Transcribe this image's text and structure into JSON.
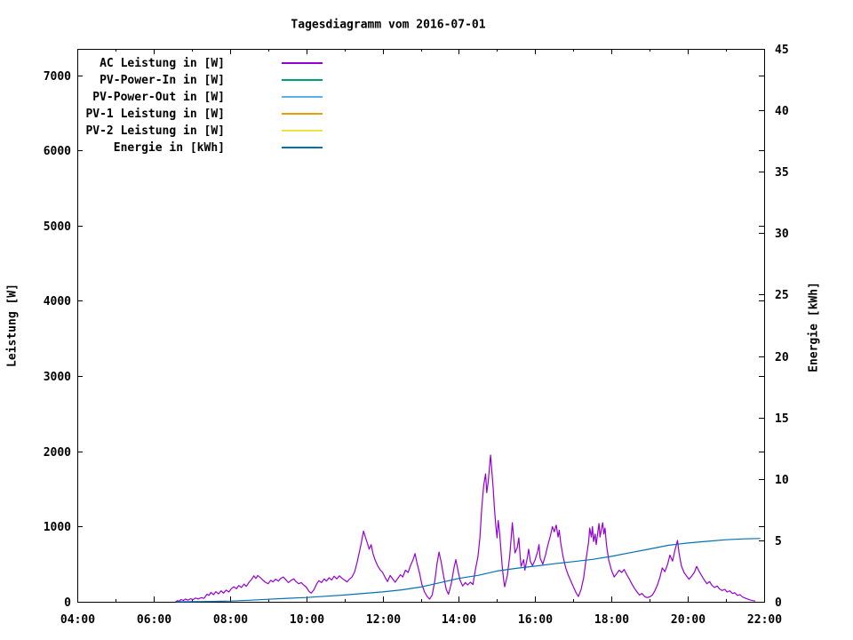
{
  "page": {
    "background": "#ffffff"
  },
  "chart_data": {
    "type": "line",
    "title": "Tagesdiagramm vom 2016-07-01",
    "ylabel": "Leistung [W]",
    "y2label": "Energie [kWh]",
    "legend_position": "top-left-inside",
    "grid": false,
    "x_axis": {
      "unit": "time",
      "start_hour": 4,
      "end_hour": 22,
      "major_tick_every_hours": 2,
      "minor_tick_every_hours": 1,
      "tick_labels": [
        "04:00",
        "06:00",
        "08:00",
        "10:00",
        "12:00",
        "14:00",
        "16:00",
        "18:00",
        "20:00",
        "22:00"
      ]
    },
    "y_axis": {
      "label": "Leistung [W]",
      "min": 0,
      "max_displayed_tick": 7000,
      "range_max": 7350,
      "tick_step": 1000,
      "tick_labels": [
        "0",
        "1000",
        "2000",
        "3000",
        "4000",
        "5000",
        "6000",
        "7000"
      ]
    },
    "y2_axis": {
      "label": "Energie [kWh]",
      "min": 0,
      "max": 45,
      "tick_step": 5,
      "tick_labels": [
        "0",
        "5",
        "10",
        "15",
        "20",
        "25",
        "30",
        "35",
        "40",
        "45"
      ]
    },
    "series": [
      {
        "name": "AC Leistung in [W]",
        "color": "#9400d3",
        "axis": "y1",
        "points": [
          [
            6.58,
            0
          ],
          [
            6.62,
            15
          ],
          [
            6.67,
            8
          ],
          [
            6.72,
            30
          ],
          [
            6.78,
            18
          ],
          [
            6.83,
            35
          ],
          [
            6.9,
            22
          ],
          [
            6.97,
            40
          ],
          [
            7.03,
            28
          ],
          [
            7.1,
            50
          ],
          [
            7.17,
            38
          ],
          [
            7.25,
            55
          ],
          [
            7.32,
            45
          ],
          [
            7.4,
            100
          ],
          [
            7.45,
            85
          ],
          [
            7.5,
            125
          ],
          [
            7.57,
            95
          ],
          [
            7.63,
            135
          ],
          [
            7.7,
            105
          ],
          [
            7.77,
            145
          ],
          [
            7.83,
            115
          ],
          [
            7.9,
            155
          ],
          [
            7.97,
            130
          ],
          [
            8.03,
            170
          ],
          [
            8.1,
            200
          ],
          [
            8.17,
            175
          ],
          [
            8.23,
            215
          ],
          [
            8.3,
            190
          ],
          [
            8.37,
            235
          ],
          [
            8.43,
            205
          ],
          [
            8.5,
            260
          ],
          [
            8.57,
            300
          ],
          [
            8.63,
            345
          ],
          [
            8.68,
            310
          ],
          [
            8.73,
            350
          ],
          [
            8.8,
            320
          ],
          [
            8.87,
            285
          ],
          [
            8.93,
            260
          ],
          [
            9.0,
            240
          ],
          [
            9.07,
            285
          ],
          [
            9.13,
            265
          ],
          [
            9.2,
            300
          ],
          [
            9.27,
            275
          ],
          [
            9.33,
            310
          ],
          [
            9.4,
            330
          ],
          [
            9.47,
            290
          ],
          [
            9.53,
            255
          ],
          [
            9.6,
            285
          ],
          [
            9.67,
            305
          ],
          [
            9.73,
            270
          ],
          [
            9.8,
            240
          ],
          [
            9.87,
            255
          ],
          [
            9.93,
            225
          ],
          [
            10.0,
            195
          ],
          [
            10.07,
            140
          ],
          [
            10.13,
            115
          ],
          [
            10.2,
            160
          ],
          [
            10.27,
            235
          ],
          [
            10.33,
            280
          ],
          [
            10.4,
            255
          ],
          [
            10.47,
            305
          ],
          [
            10.53,
            275
          ],
          [
            10.6,
            320
          ],
          [
            10.67,
            290
          ],
          [
            10.73,
            340
          ],
          [
            10.8,
            305
          ],
          [
            10.87,
            345
          ],
          [
            10.93,
            315
          ],
          [
            11.0,
            290
          ],
          [
            11.07,
            265
          ],
          [
            11.13,
            300
          ],
          [
            11.2,
            330
          ],
          [
            11.27,
            400
          ],
          [
            11.33,
            520
          ],
          [
            11.4,
            680
          ],
          [
            11.45,
            800
          ],
          [
            11.5,
            940
          ],
          [
            11.55,
            860
          ],
          [
            11.6,
            780
          ],
          [
            11.65,
            700
          ],
          [
            11.7,
            760
          ],
          [
            11.75,
            640
          ],
          [
            11.8,
            560
          ],
          [
            11.87,
            480
          ],
          [
            11.93,
            430
          ],
          [
            12.0,
            390
          ],
          [
            12.07,
            320
          ],
          [
            12.13,
            270
          ],
          [
            12.2,
            350
          ],
          [
            12.27,
            300
          ],
          [
            12.33,
            260
          ],
          [
            12.4,
            310
          ],
          [
            12.47,
            360
          ],
          [
            12.53,
            330
          ],
          [
            12.6,
            420
          ],
          [
            12.67,
            390
          ],
          [
            12.73,
            480
          ],
          [
            12.8,
            560
          ],
          [
            12.85,
            640
          ],
          [
            12.9,
            520
          ],
          [
            12.97,
            380
          ],
          [
            13.03,
            230
          ],
          [
            13.1,
            130
          ],
          [
            13.17,
            70
          ],
          [
            13.23,
            35
          ],
          [
            13.3,
            90
          ],
          [
            13.37,
            280
          ],
          [
            13.43,
            520
          ],
          [
            13.48,
            660
          ],
          [
            13.53,
            540
          ],
          [
            13.6,
            340
          ],
          [
            13.67,
            160
          ],
          [
            13.73,
            100
          ],
          [
            13.8,
            240
          ],
          [
            13.87,
            450
          ],
          [
            13.92,
            560
          ],
          [
            13.97,
            430
          ],
          [
            14.03,
            290
          ],
          [
            14.1,
            210
          ],
          [
            14.17,
            255
          ],
          [
            14.23,
            225
          ],
          [
            14.3,
            260
          ],
          [
            14.37,
            230
          ],
          [
            14.43,
            420
          ],
          [
            14.5,
            600
          ],
          [
            14.55,
            850
          ],
          [
            14.6,
            1250
          ],
          [
            14.65,
            1550
          ],
          [
            14.7,
            1700
          ],
          [
            14.73,
            1450
          ],
          [
            14.77,
            1600
          ],
          [
            14.8,
            1780
          ],
          [
            14.83,
            1950
          ],
          [
            14.87,
            1700
          ],
          [
            14.9,
            1500
          ],
          [
            14.93,
            1250
          ],
          [
            14.97,
            1000
          ],
          [
            15.0,
            850
          ],
          [
            15.03,
            1080
          ],
          [
            15.07,
            900
          ],
          [
            15.1,
            700
          ],
          [
            15.13,
            500
          ],
          [
            15.17,
            300
          ],
          [
            15.2,
            200
          ],
          [
            15.27,
            350
          ],
          [
            15.33,
            600
          ],
          [
            15.37,
            850
          ],
          [
            15.4,
            1050
          ],
          [
            15.43,
            880
          ],
          [
            15.47,
            650
          ],
          [
            15.53,
            720
          ],
          [
            15.57,
            850
          ],
          [
            15.6,
            640
          ],
          [
            15.63,
            470
          ],
          [
            15.7,
            560
          ],
          [
            15.73,
            420
          ],
          [
            15.8,
            600
          ],
          [
            15.83,
            700
          ],
          [
            15.87,
            540
          ],
          [
            15.93,
            480
          ],
          [
            16.0,
            560
          ],
          [
            16.07,
            680
          ],
          [
            16.1,
            760
          ],
          [
            16.13,
            580
          ],
          [
            16.2,
            500
          ],
          [
            16.27,
            620
          ],
          [
            16.33,
            750
          ],
          [
            16.4,
            880
          ],
          [
            16.45,
            1000
          ],
          [
            16.5,
            930
          ],
          [
            16.55,
            1020
          ],
          [
            16.6,
            860
          ],
          [
            16.63,
            950
          ],
          [
            16.67,
            780
          ],
          [
            16.73,
            600
          ],
          [
            16.8,
            450
          ],
          [
            16.87,
            350
          ],
          [
            16.93,
            280
          ],
          [
            17.0,
            200
          ],
          [
            17.07,
            120
          ],
          [
            17.13,
            70
          ],
          [
            17.2,
            160
          ],
          [
            17.27,
            320
          ],
          [
            17.33,
            550
          ],
          [
            17.4,
            800
          ],
          [
            17.43,
            980
          ],
          [
            17.47,
            860
          ],
          [
            17.5,
            1000
          ],
          [
            17.53,
            800
          ],
          [
            17.57,
            900
          ],
          [
            17.6,
            760
          ],
          [
            17.63,
            880
          ],
          [
            17.67,
            1040
          ],
          [
            17.7,
            860
          ],
          [
            17.73,
            950
          ],
          [
            17.77,
            1050
          ],
          [
            17.8,
            900
          ],
          [
            17.83,
            980
          ],
          [
            17.87,
            750
          ],
          [
            17.93,
            550
          ],
          [
            18.0,
            420
          ],
          [
            18.07,
            330
          ],
          [
            18.13,
            370
          ],
          [
            18.2,
            420
          ],
          [
            18.27,
            390
          ],
          [
            18.33,
            430
          ],
          [
            18.4,
            360
          ],
          [
            18.47,
            300
          ],
          [
            18.53,
            240
          ],
          [
            18.6,
            180
          ],
          [
            18.67,
            130
          ],
          [
            18.73,
            90
          ],
          [
            18.8,
            110
          ],
          [
            18.87,
            70
          ],
          [
            18.93,
            55
          ],
          [
            19.0,
            65
          ],
          [
            19.07,
            90
          ],
          [
            19.13,
            140
          ],
          [
            19.2,
            220
          ],
          [
            19.27,
            330
          ],
          [
            19.33,
            450
          ],
          [
            19.4,
            400
          ],
          [
            19.47,
            500
          ],
          [
            19.53,
            620
          ],
          [
            19.6,
            540
          ],
          [
            19.67,
            700
          ],
          [
            19.73,
            815
          ],
          [
            19.77,
            650
          ],
          [
            19.83,
            480
          ],
          [
            19.9,
            390
          ],
          [
            19.97,
            340
          ],
          [
            20.03,
            300
          ],
          [
            20.1,
            340
          ],
          [
            20.17,
            390
          ],
          [
            20.23,
            470
          ],
          [
            20.3,
            400
          ],
          [
            20.37,
            340
          ],
          [
            20.43,
            290
          ],
          [
            20.5,
            240
          ],
          [
            20.57,
            270
          ],
          [
            20.63,
            220
          ],
          [
            20.7,
            190
          ],
          [
            20.77,
            210
          ],
          [
            20.83,
            170
          ],
          [
            20.9,
            150
          ],
          [
            20.97,
            165
          ],
          [
            21.03,
            130
          ],
          [
            21.1,
            145
          ],
          [
            21.17,
            110
          ],
          [
            21.23,
            120
          ],
          [
            21.3,
            85
          ],
          [
            21.37,
            95
          ],
          [
            21.43,
            65
          ],
          [
            21.5,
            50
          ],
          [
            21.57,
            35
          ],
          [
            21.63,
            25
          ],
          [
            21.7,
            15
          ],
          [
            21.77,
            8
          ]
        ]
      },
      {
        "name": "PV-Power-In in [W]",
        "color": "#009e73",
        "axis": "y1",
        "points": []
      },
      {
        "name": "PV-Power-Out in [W]",
        "color": "#56b4e9",
        "axis": "y1",
        "points": []
      },
      {
        "name": "PV-1 Leistung in [W]",
        "color": "#e69f00",
        "axis": "y1",
        "points": []
      },
      {
        "name": "PV-2 Leistung in [W]",
        "color": "#f0e442",
        "axis": "y1",
        "points": []
      },
      {
        "name": "Energie in [kWh]",
        "color": "#0072b2",
        "axis": "y2",
        "points": [
          [
            6.6,
            0
          ],
          [
            7.0,
            0.01
          ],
          [
            7.5,
            0.03
          ],
          [
            8.0,
            0.06
          ],
          [
            8.5,
            0.12
          ],
          [
            9.0,
            0.2
          ],
          [
            9.5,
            0.28
          ],
          [
            10.0,
            0.35
          ],
          [
            10.5,
            0.45
          ],
          [
            11.0,
            0.55
          ],
          [
            11.5,
            0.68
          ],
          [
            12.0,
            0.8
          ],
          [
            12.5,
            0.97
          ],
          [
            13.0,
            1.2
          ],
          [
            13.5,
            1.55
          ],
          [
            14.0,
            1.9
          ],
          [
            14.5,
            2.15
          ],
          [
            15.0,
            2.5
          ],
          [
            15.5,
            2.72
          ],
          [
            16.0,
            2.9
          ],
          [
            16.5,
            3.1
          ],
          [
            17.0,
            3.27
          ],
          [
            17.5,
            3.45
          ],
          [
            18.0,
            3.7
          ],
          [
            18.5,
            4.0
          ],
          [
            19.0,
            4.3
          ],
          [
            19.5,
            4.6
          ],
          [
            20.0,
            4.78
          ],
          [
            20.5,
            4.92
          ],
          [
            21.0,
            5.05
          ],
          [
            21.5,
            5.12
          ],
          [
            21.9,
            5.15
          ]
        ]
      }
    ],
    "colors": {
      "border": "#000000",
      "text": "#000000",
      "background": "#ffffff"
    }
  }
}
